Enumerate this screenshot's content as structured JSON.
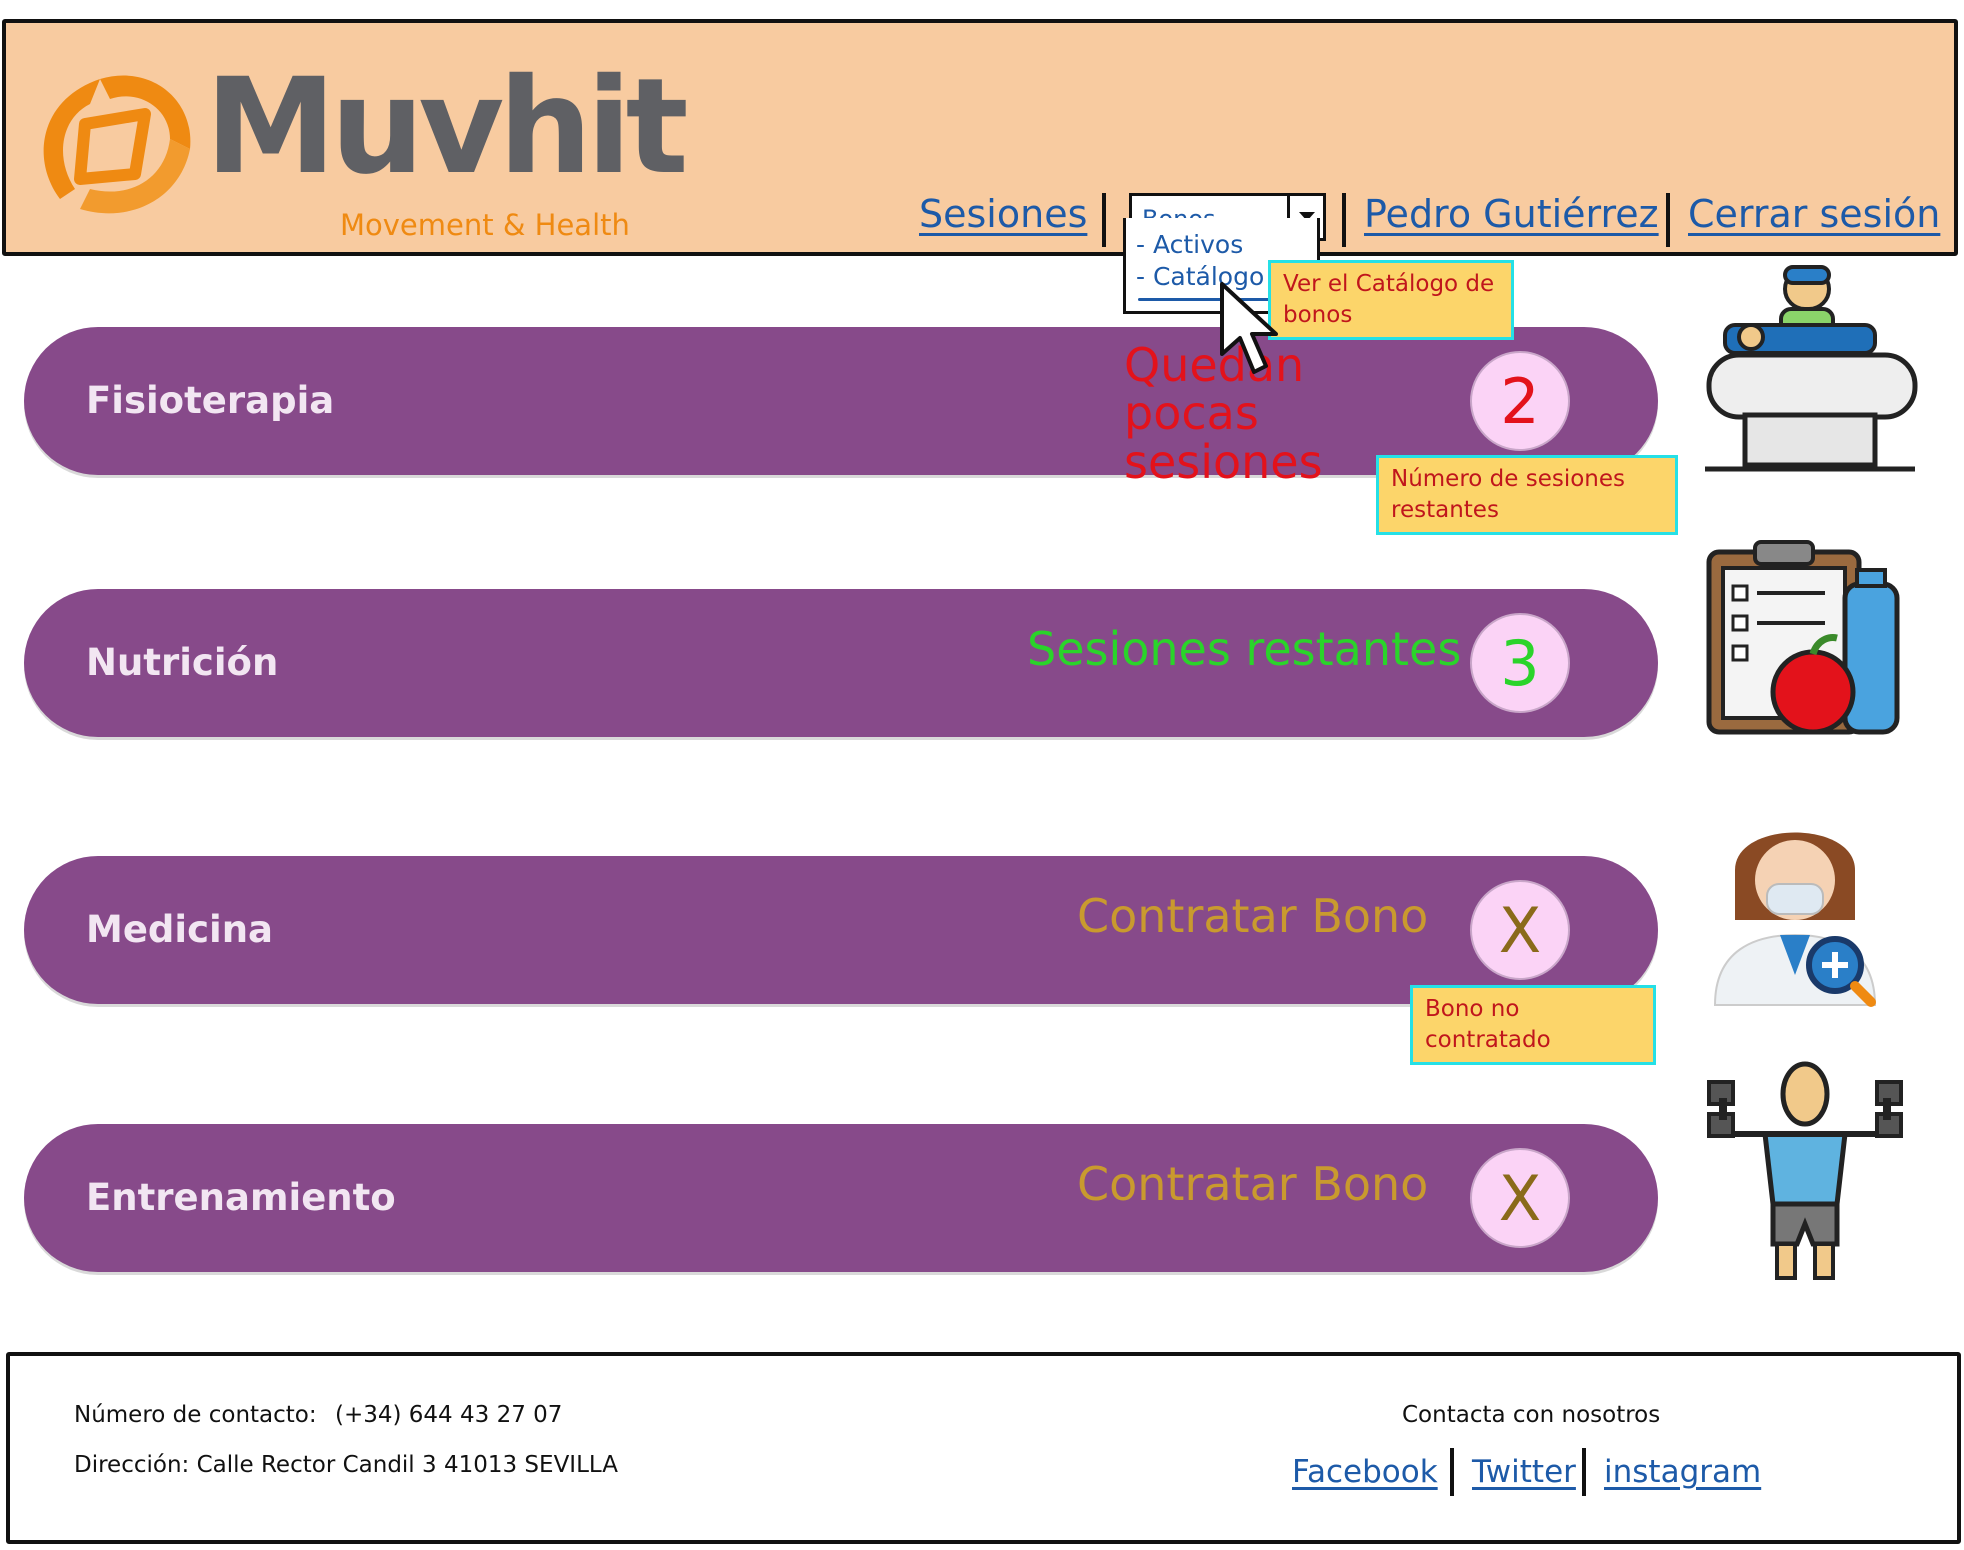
{
  "header": {
    "logo_word": "Muvhit",
    "logo_tagline": "Movement & Health",
    "nav": {
      "sessions": "Sesiones",
      "bonos_select": "Bonos",
      "user": "Pedro Gutiérrez",
      "logout": "Cerrar sesión"
    },
    "dropdown": {
      "items": [
        "- Activos",
        "- Catálogo"
      ]
    }
  },
  "services": [
    {
      "name": "Fisioterapia",
      "status": "Quedan pocas sesiones",
      "badge": "2",
      "status_color": "#e3121b",
      "icon": "physiotherapy-icon"
    },
    {
      "name": "Nutrición",
      "status": "Sesiones restantes",
      "badge": "3",
      "status_color": "#2ad42a",
      "icon": "nutrition-icon"
    },
    {
      "name": "Medicina",
      "status": "Contratar Bono",
      "badge": "X",
      "status_color": "#c99a2e",
      "icon": "doctor-icon"
    },
    {
      "name": "Entrenamiento",
      "status": "Contratar Bono",
      "badge": "X",
      "status_color": "#c99a2e",
      "icon": "training-icon"
    }
  ],
  "annotations": {
    "catalog": "Ver el Catálogo de bonos",
    "remaining": "Número de sesiones restantes",
    "not_contracted": "Bono no contratado"
  },
  "footer": {
    "phone_label": "Número de contacto:",
    "phone": "(+34) 644 43 27 07",
    "address": "Dirección: Calle Rector Candil 3 41013 SEVILLA",
    "contact_title": "Contacta con nosotros",
    "links": [
      "Facebook",
      "Twitter",
      "instagram"
    ]
  },
  "colors": {
    "header_bg": "#f8cba0",
    "bar": "#874a8a",
    "badge": "#fbd3f6",
    "link": "#1d5aa8",
    "note_bg": "#fcd56a",
    "note_border": "#25e0e6"
  }
}
